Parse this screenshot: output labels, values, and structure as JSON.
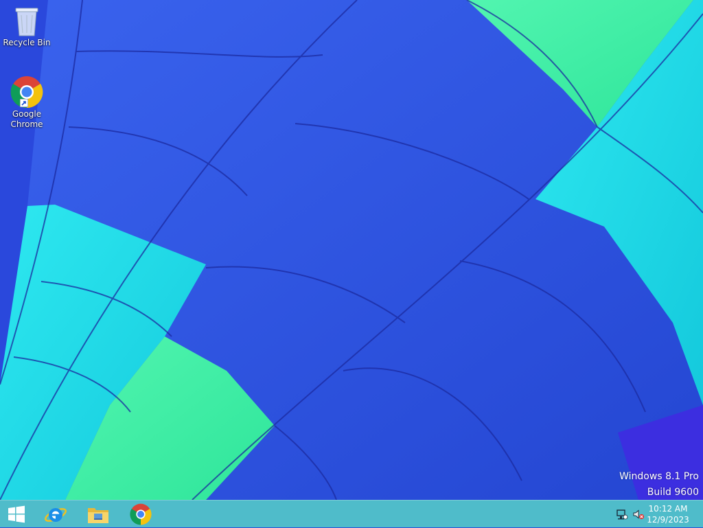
{
  "desktop": {
    "icons": [
      {
        "label": "Recycle Bin",
        "icon": "recycle-bin-icon"
      },
      {
        "label": "Google Chrome",
        "icon": "chrome-icon"
      }
    ],
    "watermark": {
      "line1": "Windows 8.1 Pro",
      "line2": "Build 9600"
    }
  },
  "taskbar": {
    "pinned": [
      {
        "icon": "windows-start-icon"
      },
      {
        "icon": "internet-explorer-icon"
      },
      {
        "icon": "file-explorer-icon"
      },
      {
        "icon": "chrome-icon"
      }
    ],
    "tray": {
      "network_icon": "network-icon",
      "volume_icon": "volume-muted-icon",
      "time": "10:12 AM",
      "date": "12/9/2023"
    }
  },
  "colors": {
    "taskbar": "#52c4c8",
    "wallpaper_blue": "#2f5ae0",
    "wallpaper_cyan": "#22e3ea",
    "wallpaper_green": "#3ff2a8"
  }
}
